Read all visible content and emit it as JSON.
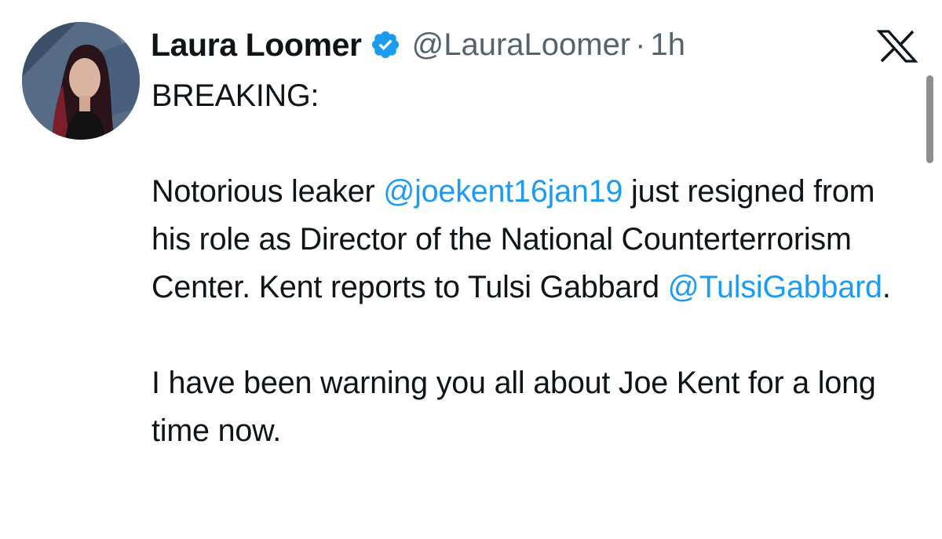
{
  "tweet": {
    "author_name": "Laura Loomer",
    "handle": "@LauraLoomer",
    "dot": "·",
    "time": "1h",
    "verified_icon": "verified-badge-icon",
    "logo_icon": "x-logo-icon",
    "colors": {
      "text": "#0f1419",
      "muted": "#536471",
      "link": "#1d9bf0"
    },
    "body": {
      "line1": "BREAKING:",
      "p2_a": "Notorious leaker ",
      "p2_mention1": "@joekent16jan19",
      "p2_b": " just resigned from his role as Director of the National Counterterrorism Center. Kent reports to Tulsi Gabbard ",
      "p2_mention2": "@TulsiGabbard",
      "p2_c": ".",
      "p3": "I have been warning you all about Joe Kent for a long time now."
    }
  }
}
